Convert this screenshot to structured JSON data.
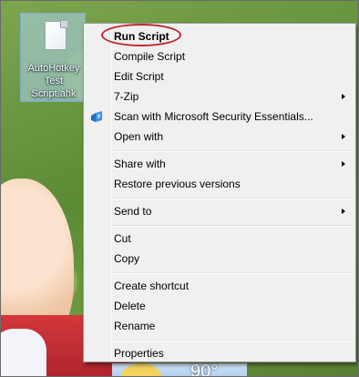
{
  "desktop": {
    "file_icon_label": "AutoHotkey\nTest\nScript.ahk",
    "widget_temperature": "90°"
  },
  "context_menu": {
    "items": [
      {
        "label": "Run Script",
        "bold": true
      },
      {
        "label": "Compile Script"
      },
      {
        "label": "Edit Script"
      },
      {
        "label": "7-Zip",
        "submenu": true
      },
      {
        "label": "Scan with Microsoft Security Essentials...",
        "icon": "security-essentials-icon"
      },
      {
        "label": "Open with",
        "submenu": true
      },
      {
        "label": "Share with",
        "submenu": true
      },
      {
        "label": "Restore previous versions"
      },
      {
        "label": "Send to",
        "submenu": true
      },
      {
        "label": "Cut"
      },
      {
        "label": "Copy"
      },
      {
        "label": "Create shortcut"
      },
      {
        "label": "Delete"
      },
      {
        "label": "Rename"
      },
      {
        "label": "Properties"
      }
    ]
  },
  "colors": {
    "menu_background": "#f0f0f0",
    "highlight_ring": "#c0262d"
  }
}
